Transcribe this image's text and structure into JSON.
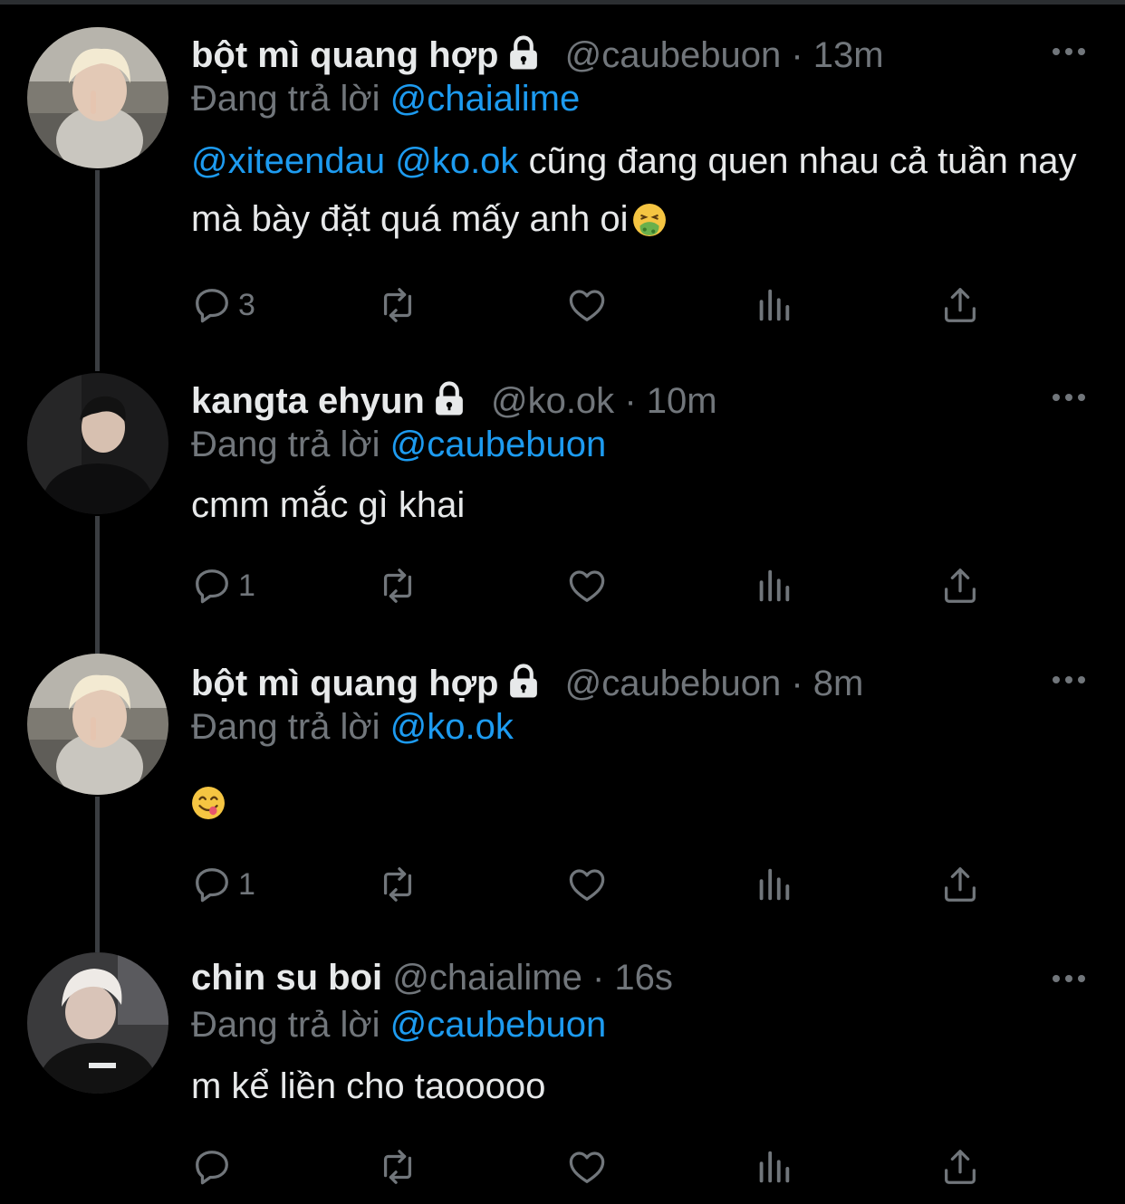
{
  "colors": {
    "background": "#000000",
    "text": "#e7e9ea",
    "muted": "#71767b",
    "link": "#1d9bf0",
    "thread_line": "#3a3d41"
  },
  "reply_prefix": "Đang trả lời",
  "tweets": [
    {
      "name": "bột mì quang hợp",
      "locked": true,
      "handle": "@caubebuon",
      "dot": "·",
      "time": "13m",
      "reply_to": "@chaialime",
      "mentions": [
        "@xiteendau",
        "@ko.ok"
      ],
      "text": "cũng đang quen nhau cả tuần nay mà bày đặt quá mấy anh oi",
      "emoji": "nauseated-face",
      "reply_count": "3"
    },
    {
      "name": "kangta ehyun",
      "locked": true,
      "handle": "@ko.ok",
      "dot": "·",
      "time": "10m",
      "reply_to": "@caubebuon",
      "text": "cmm mắc gì khai",
      "reply_count": "1"
    },
    {
      "name": "bột mì quang hợp",
      "locked": true,
      "handle": "@caubebuon",
      "dot": "·",
      "time": "8m",
      "reply_to": "@ko.ok",
      "text": "",
      "emoji": "face-savoring-food",
      "reply_count": "1"
    },
    {
      "name": "chin su boi",
      "locked": false,
      "handle": "@chaialime",
      "dot": "·",
      "time": "16s",
      "reply_to": "@caubebuon",
      "text": "m kể liền cho taooooo",
      "reply_count": ""
    }
  ],
  "icons": {
    "reply": "reply-icon",
    "retweet": "retweet-icon",
    "like": "heart-icon",
    "views": "views-icon",
    "share": "share-icon",
    "more": "more-icon",
    "lock": "lock-icon"
  }
}
